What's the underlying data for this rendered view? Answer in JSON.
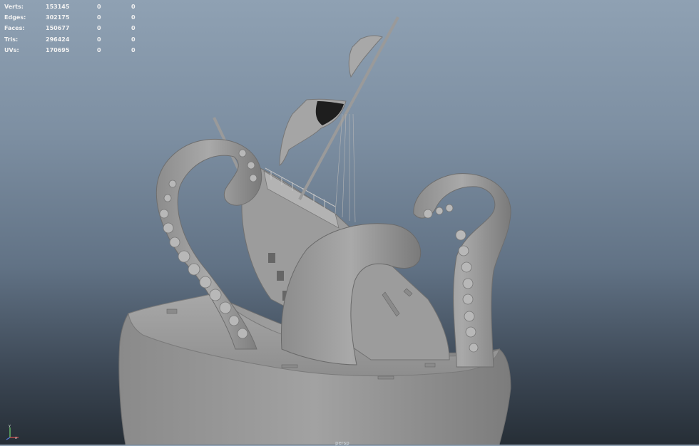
{
  "hud": {
    "rows": [
      {
        "label": "Verts:",
        "total": "153145",
        "selected": "0",
        "component": "0"
      },
      {
        "label": "Edges:",
        "total": "302175",
        "selected": "0",
        "component": "0"
      },
      {
        "label": "Faces:",
        "total": "150677",
        "selected": "0",
        "component": "0"
      },
      {
        "label": "Tris:",
        "total": "296424",
        "selected": "0",
        "component": "0"
      },
      {
        "label": "UVs:",
        "total": "170695",
        "selected": "0",
        "component": "0"
      }
    ]
  },
  "axis": {
    "y_label": "y",
    "x_label": "x",
    "y_color": "#6fd56f",
    "x_color": "#e05555",
    "z_color": "#5a7be0"
  },
  "viewport": {
    "camera_label": "persp",
    "background_top": "#8fa1b3",
    "background_bottom": "#262e36",
    "model_color": "#9a9a9a"
  }
}
